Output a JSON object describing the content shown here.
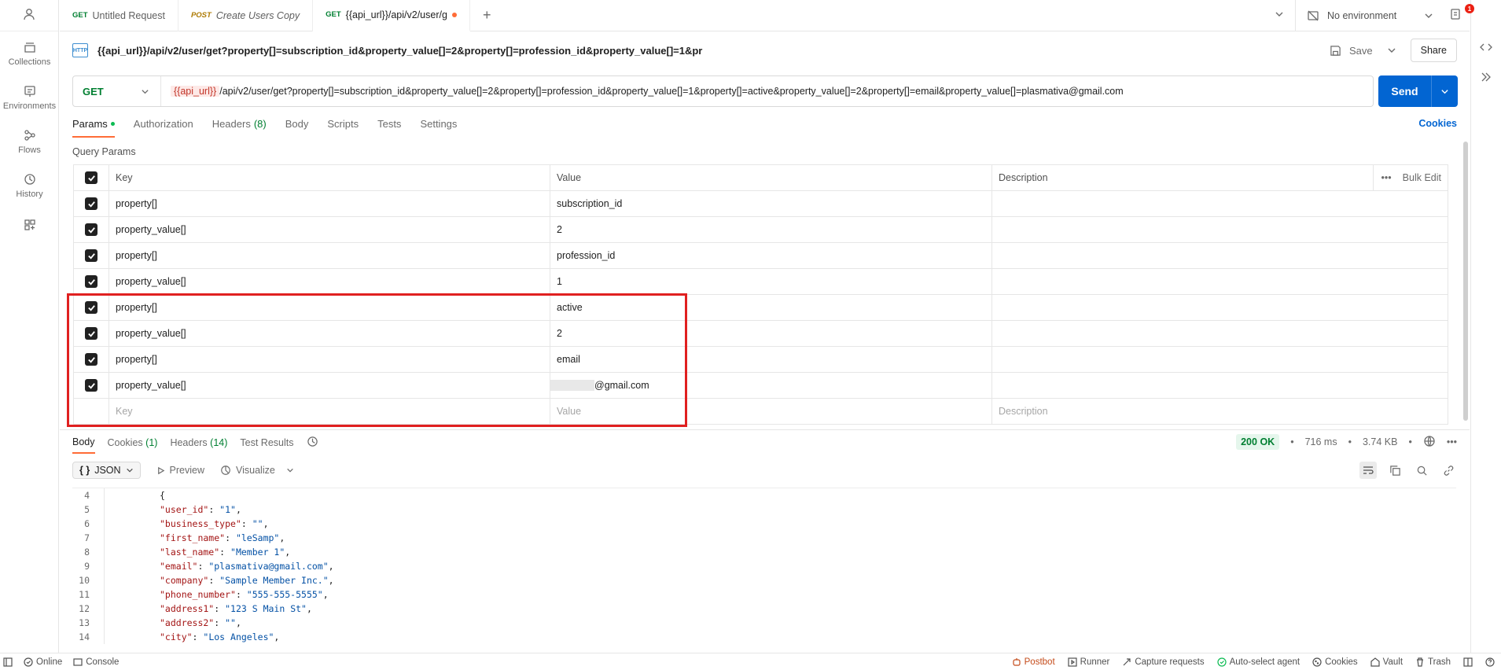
{
  "sidebar": {
    "items": [
      {
        "label": "Collections",
        "icon": "collections-icon"
      },
      {
        "label": "Environments",
        "icon": "environments-icon"
      },
      {
        "label": "Flows",
        "icon": "flows-icon"
      },
      {
        "label": "History",
        "icon": "history-icon"
      }
    ]
  },
  "tabs": [
    {
      "method": "GET",
      "label": "Untitled Request"
    },
    {
      "method": "POST",
      "label": "Create Users Copy"
    },
    {
      "method": "GET",
      "label": "{{api_url}}/api/v2/user/g"
    }
  ],
  "environment": {
    "label": "No environment",
    "notification_count": "1"
  },
  "request": {
    "title": "{{api_url}}/api/v2/user/get?property[]=subscription_id&property_value[]=2&property[]=profession_id&property_value[]=1&pr",
    "save_label": "Save",
    "share_label": "Share",
    "icon_text": "HTTP",
    "method": "GET",
    "url_variable": "{{api_url}}",
    "url_rest": "/api/v2/user/get?property[]=subscription_id&property_value[]=2&property[]=profession_id&property_value[]=1&property[]=active&property_value[]=2&property[]=email&property_value[]=plasmativa@gmail.com",
    "send_label": "Send"
  },
  "request_tabs": {
    "params": "Params",
    "authorization": "Authorization",
    "headers": "Headers",
    "headers_count": "(8)",
    "body": "Body",
    "scripts": "Scripts",
    "tests": "Tests",
    "settings": "Settings",
    "cookies": "Cookies"
  },
  "query_params": {
    "title": "Query Params",
    "headers": {
      "key": "Key",
      "value": "Value",
      "description": "Description",
      "bulk_edit": "Bulk Edit"
    },
    "rows": [
      {
        "key": "property[]",
        "value": "subscription_id"
      },
      {
        "key": "property_value[]",
        "value": "2"
      },
      {
        "key": "property[]",
        "value": "profession_id"
      },
      {
        "key": "property_value[]",
        "value": "1"
      },
      {
        "key": "property[]",
        "value": "active"
      },
      {
        "key": "property_value[]",
        "value": "2"
      },
      {
        "key": "property[]",
        "value": "email"
      },
      {
        "key": "property_value[]",
        "value": "@gmail.com"
      }
    ],
    "placeholder": {
      "key": "Key",
      "value": "Value",
      "description": "Description"
    }
  },
  "response": {
    "tabs": {
      "body": "Body",
      "cookies": "Cookies",
      "cookies_count": "(1)",
      "headers": "Headers",
      "headers_count": "(14)",
      "test_results": "Test Results"
    },
    "status": "200 OK",
    "time": "716 ms",
    "size": "3.74 KB",
    "format": "JSON",
    "preview": "Preview",
    "visualize": "Visualize",
    "lines": [
      {
        "n": "4",
        "indent": 0,
        "key": "",
        "val": "",
        "raw": "{"
      },
      {
        "n": "5",
        "indent": 1,
        "key": "\"user_id\"",
        "val": "\"1\""
      },
      {
        "n": "6",
        "indent": 1,
        "key": "\"business_type\"",
        "val": "\"\""
      },
      {
        "n": "7",
        "indent": 1,
        "key": "\"first_name\"",
        "val": "\"leSamp\""
      },
      {
        "n": "8",
        "indent": 1,
        "key": "\"last_name\"",
        "val": "\"Member 1\""
      },
      {
        "n": "9",
        "indent": 1,
        "key": "\"email\"",
        "val": "\"plasmativa@gmail.com\""
      },
      {
        "n": "10",
        "indent": 1,
        "key": "\"company\"",
        "val": "\"Sample Member Inc.\""
      },
      {
        "n": "11",
        "indent": 1,
        "key": "\"phone_number\"",
        "val": "\"555-555-5555\""
      },
      {
        "n": "12",
        "indent": 1,
        "key": "\"address1\"",
        "val": "\"123 S Main St\""
      },
      {
        "n": "13",
        "indent": 1,
        "key": "\"address2\"",
        "val": "\"\""
      },
      {
        "n": "14",
        "indent": 1,
        "key": "\"city\"",
        "val": "\"Los Angeles\""
      }
    ]
  },
  "statusbar": {
    "online": "Online",
    "console": "Console",
    "postbot": "Postbot",
    "runner": "Runner",
    "capture": "Capture requests",
    "auto_agent": "Auto-select agent",
    "cookies": "Cookies",
    "vault": "Vault",
    "trash": "Trash"
  }
}
